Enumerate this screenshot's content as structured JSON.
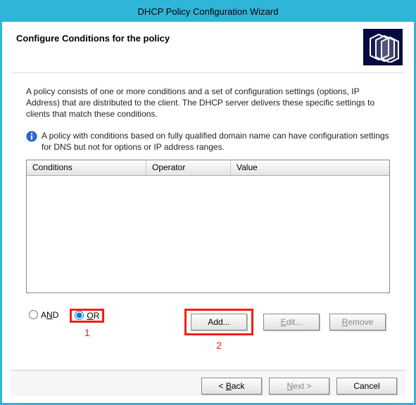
{
  "window": {
    "title": "DHCP Policy Configuration Wizard"
  },
  "header": {
    "title": "Configure Conditions for the policy"
  },
  "description": "A policy consists of one or more conditions and a set of configuration settings (options, IP Address) that are distributed to the client. The DHCP server delivers these specific settings to clients that match these conditions.",
  "note": "A policy with conditions based on fully qualified domain name can have configuration settings for DNS but not for options or IP address ranges.",
  "table": {
    "columns": {
      "c1": "Conditions",
      "c2": "Operator",
      "c3": "Value"
    }
  },
  "logic": {
    "and_label_pre": "A",
    "and_label_u": "N",
    "and_label_post": "D",
    "or_label_u": "O",
    "or_label_post": "R",
    "selected": "or"
  },
  "buttons": {
    "add": "Add...",
    "edit_u": "E",
    "edit_post": "dit...",
    "remove_u": "R",
    "remove_post": "emove"
  },
  "annotations": {
    "one": "1",
    "two": "2"
  },
  "footer": {
    "back_pre": "< ",
    "back_u": "B",
    "back_post": "ack",
    "next_u": "N",
    "next_post": "ext >",
    "cancel": "Cancel"
  }
}
